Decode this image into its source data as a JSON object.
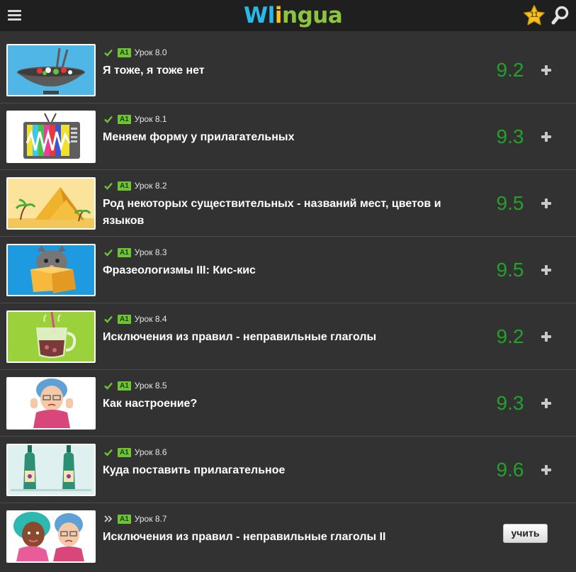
{
  "header": {
    "logo_parts": [
      "W",
      "l",
      "i",
      "n",
      "g",
      "u",
      "a"
    ],
    "stars_count": "11",
    "icons": [
      "menu-icon",
      "star-icon",
      "search-icon"
    ]
  },
  "colors": {
    "background": "#323232",
    "header": "#1f1f1f",
    "score_green": "#22a22b",
    "badge_green": "#6ec534",
    "logo_blue": "#29b8e8",
    "logo_green": "#8bc53f",
    "logo_yellow": "#f7c21d"
  },
  "lessons": [
    {
      "status": "completed",
      "status_icon": "check-icon",
      "level": "A1",
      "number": "Урок 8.0",
      "title": "Я тоже, я тоже нет",
      "score": "9.2",
      "thumbnail": "salad-bowl-image"
    },
    {
      "status": "completed",
      "status_icon": "check-icon",
      "level": "A1",
      "number": "Урок 8.1",
      "title": "Меняем форму у прилагательных",
      "score": "9.3",
      "thumbnail": "tv-image"
    },
    {
      "status": "completed",
      "status_icon": "check-icon",
      "level": "A1",
      "number": "Урок 8.2",
      "title": "Род некоторых существительных - названий мест, цветов и языков",
      "score": "9.5",
      "thumbnail": "pyramids-image"
    },
    {
      "status": "completed",
      "status_icon": "check-icon",
      "level": "A1",
      "number": "Урок 8.3",
      "title": "Фразеологизмы III: Кис-кис",
      "score": "9.5",
      "thumbnail": "cat-in-box-image"
    },
    {
      "status": "completed",
      "status_icon": "check-icon",
      "level": "A1",
      "number": "Урок 8.4",
      "title": "Исключения из правил - неправильные глаголы",
      "score": "9.2",
      "thumbnail": "hot-drink-image"
    },
    {
      "status": "completed",
      "status_icon": "check-icon",
      "level": "A1",
      "number": "Урок 8.5",
      "title": "Как настроение?",
      "score": "9.3",
      "thumbnail": "upset-grandma-image"
    },
    {
      "status": "completed",
      "status_icon": "check-icon",
      "level": "A1",
      "number": "Урок 8.6",
      "title": "Куда поставить прилагательное",
      "score": "9.6",
      "thumbnail": "wine-bottles-image"
    },
    {
      "status": "next",
      "status_icon": "double-chevron-icon",
      "level": "A1",
      "number": "Урок 8.7",
      "title": "Исключения из правил - неправильные глаголы II",
      "action_label": "учить",
      "thumbnail": "two-women-image"
    }
  ]
}
